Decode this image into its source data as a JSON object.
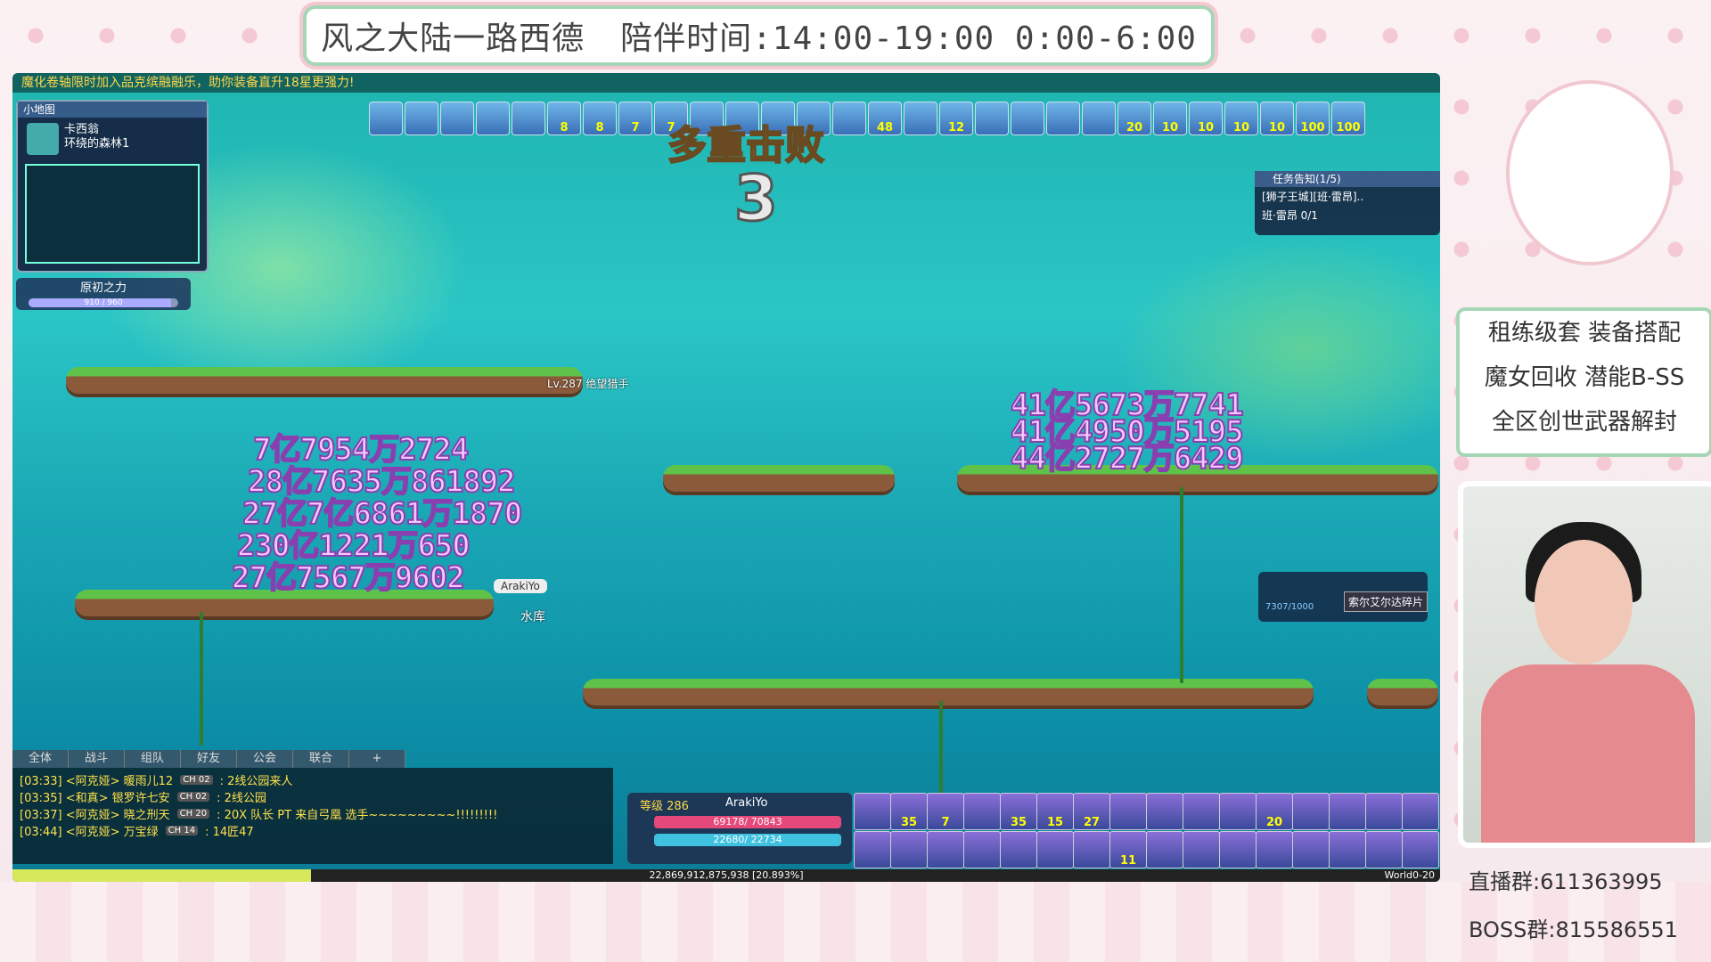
{
  "stream": {
    "title": "风之大陆一路西德",
    "schedule": "陪伴时间:14:00-19:00 0:00-6:00",
    "right_menu": [
      "租练级套 装备搭配",
      "魔女回收 潜能B-SS",
      "全区创世武器解封"
    ],
    "qq_group": "直播群:611363995",
    "boss_group": "BOSS群:815586551"
  },
  "game": {
    "notice": "魔化卷轴限时加入品克缤融融乐，助你装备直升18星更强力!",
    "minimap": {
      "header": "小地图",
      "map_name": "卡西翁",
      "map_sub": "环绕的森林1"
    },
    "power": {
      "label": "原初之力",
      "value": "910 / 960",
      "fill_fraction": 0.95
    },
    "buffs": [
      "",
      "",
      "",
      "",
      "",
      "8",
      "8",
      "7",
      "7",
      "",
      "",
      "",
      "",
      "",
      "48",
      "",
      "12",
      "",
      "",
      "",
      "",
      "20",
      "10",
      "10",
      "10",
      "10",
      "100",
      "100"
    ],
    "combo": {
      "label": "多重击败",
      "count": "3"
    },
    "damage_left": [
      "7亿7954万2724",
      "28亿7635万861892",
      "27亿7亿6861万1870",
      "230亿1221万650",
      "27亿7567万9602"
    ],
    "damage_right": [
      "41亿5673万7741",
      "41亿4950万5195",
      "44亿2727万6429"
    ],
    "monster_label": "Lv.287 绝望猎手",
    "player_tag": "ArakiYo",
    "player_job": "水库",
    "quest": {
      "header": "任务告知(1/5)",
      "line1": "[狮子王城][班·雷昂]..",
      "line2": "班·雷昂 0/1"
    },
    "shard": {
      "label": "索尔艾尔达碎片",
      "value": "7307/1000"
    },
    "chat_tabs": [
      "全体",
      "战斗",
      "组队",
      "好友",
      "公会",
      "联合",
      "+"
    ],
    "chat": [
      {
        "time": "[03:33]",
        "who": "<阿克娅> 暖雨儿12",
        "ch": "CH 02",
        "msg": ": 2线公园来人"
      },
      {
        "time": "[03:35]",
        "who": "<和真> 银罗许七安",
        "ch": "CH 02",
        "msg": ": 2线公园"
      },
      {
        "time": "[03:37]",
        "who": "<阿克娅> 晓之刑天",
        "ch": "CH 20",
        "msg": ": 20X 队长 PT 来自弓凰 选手~~~~~~~~~!!!!!!!!!"
      },
      {
        "time": "[03:44]",
        "who": "<阿克娅> 万宝绿",
        "ch": "CH 14",
        "msg": ": 14匠47"
      }
    ],
    "status": {
      "level": "等级 286",
      "name": "ArakiYo",
      "hp": "69178/ 70843",
      "mp": "22680/ 22734"
    },
    "exp": {
      "text": "22,869,912,875,938 [20.893%]",
      "fraction": 0.209
    },
    "world": "World0-20",
    "skills_row1": [
      "",
      "35",
      "7",
      "",
      "35",
      "15",
      "27",
      "",
      "",
      "",
      "",
      "20",
      "",
      "",
      "",
      ""
    ],
    "skills_row2": [
      "",
      "",
      "",
      "",
      "",
      "",
      "",
      "11",
      "",
      "",
      "",
      "",
      "",
      "",
      "",
      ""
    ]
  }
}
